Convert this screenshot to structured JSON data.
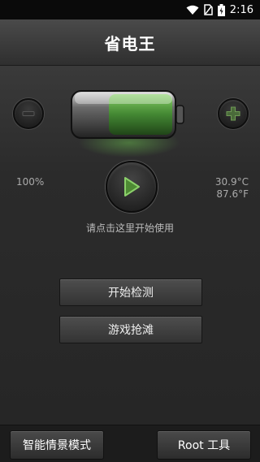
{
  "status_bar": {
    "time": "2:16",
    "icons": [
      "wifi-icon",
      "no-sim-icon",
      "battery-charging-icon"
    ]
  },
  "header": {
    "title": "省电王"
  },
  "battery_panel": {
    "percent_text": "100%",
    "temp_c": "30.9°C",
    "temp_f": "87.6°F",
    "decrease_icon": "minus-icon",
    "increase_icon": "plus-icon",
    "play_icon": "play-icon",
    "hint": "请点击这里开始使用"
  },
  "actions": {
    "start_check": "开始检测",
    "game_rush": "游戏抢滩"
  },
  "bottom_bar": {
    "smart_mode": "智能情景模式",
    "root_tools": "Root 工具"
  },
  "colors": {
    "accent_green": "#5fb03c",
    "background": "#2a2a2a"
  }
}
